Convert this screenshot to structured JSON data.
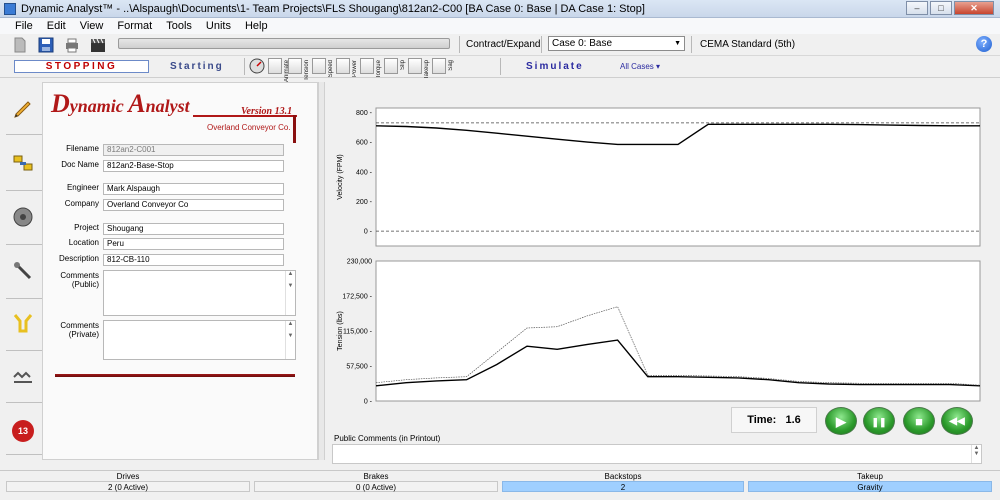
{
  "window": {
    "title": "Dynamic Analyst™ - ..\\Alspaugh\\Documents\\1- Team Projects\\FLS Shougang\\812an2-C00 [BA Case 0: Base | DA Case 1: Stop]",
    "minimize": "–",
    "maximize": "□",
    "close": "✕"
  },
  "menu": [
    "File",
    "Edit",
    "View",
    "Format",
    "Tools",
    "Units",
    "Help"
  ],
  "toolbar": {
    "contract_expand": "Contract/Expand",
    "case_select": "Case 0: Base",
    "standard": "CEMA Standard (5th)",
    "help": "?"
  },
  "modes": {
    "stopping": "STOPPING",
    "starting": "Starting",
    "simulate": "Simulate",
    "all_cases": "All Cases ▾",
    "tools": [
      "Animate",
      "Tension",
      "Speed",
      "Power",
      "Torque",
      "Slip",
      "Takeup",
      "Sag"
    ]
  },
  "sidebar": {
    "icons": [
      "pencil-icon",
      "drive-icon",
      "pulley-icon",
      "probe-icon",
      "takeup-icon",
      "belt-icon",
      "case-badge-icon"
    ],
    "badge": "13"
  },
  "logo": {
    "title_cap1": "D",
    "title_rest1": "ynamic ",
    "title_cap2": "A",
    "title_rest2": "nalyst",
    "version": "Version 13.1",
    "company": "Overland Conveyor Co."
  },
  "form": {
    "filename_label": "Filename",
    "filename": "812an2-C001",
    "docname_label": "Doc Name",
    "docname": "812an2-Base-Stop",
    "engineer_label": "Engineer",
    "engineer": "Mark Alspaugh",
    "company_label": "Company",
    "company": "Overland Conveyor Co",
    "project_label": "Project",
    "project": "Shougang",
    "location_label": "Location",
    "location": "Peru",
    "description_label": "Description",
    "description": "812-CB-110",
    "comments_public_label": "Comments (Public)",
    "comments_private_label": "Comments (Private)"
  },
  "chart_data": [
    {
      "type": "line",
      "ylabel": "Velocity (FPM)",
      "ylim": [
        -100,
        830
      ],
      "yticks": [
        "800 -",
        "600 -",
        "400 -",
        "200 -",
        "0 -"
      ],
      "x": [
        0,
        1,
        2,
        3,
        4,
        5,
        6,
        7,
        8,
        9,
        10,
        11,
        12,
        13,
        14,
        15,
        16,
        17,
        18,
        19,
        20
      ],
      "series": [
        {
          "values": [
            710,
            705,
            695,
            680,
            660,
            640,
            620,
            600,
            585,
            585,
            585,
            720,
            720,
            720,
            720,
            720,
            718,
            715,
            712,
            710,
            710
          ]
        }
      ],
      "reference_lines": [
        730,
        0
      ]
    },
    {
      "type": "line",
      "ylabel": "Tension (lbs)",
      "ylim": [
        0,
        230000
      ],
      "yticks": [
        "230,000",
        "172,500 -",
        "115,000 -",
        "57,500 -",
        "0 -"
      ],
      "x": [
        0,
        1,
        2,
        3,
        4,
        5,
        6,
        7,
        8,
        9,
        10,
        11,
        12,
        13,
        14,
        15,
        16,
        17,
        18,
        19,
        20
      ],
      "series": [
        {
          "values": [
            25000,
            30000,
            33000,
            35000,
            60000,
            90000,
            85000,
            93000,
            100000,
            40000,
            40000,
            39000,
            38000,
            35000,
            30000,
            28000,
            27000,
            27000,
            27000,
            27000,
            25000
          ]
        },
        {
          "values": [
            30000,
            35000,
            38000,
            40000,
            80000,
            120000,
            122000,
            140000,
            155000,
            42000,
            42000,
            41000,
            40000,
            37000,
            32000,
            30000,
            29000,
            29000,
            29000,
            29000,
            26000
          ]
        }
      ]
    }
  ],
  "playback": {
    "time_label": "Time:",
    "time_value": "1.6",
    "play": "▶",
    "pause": "❚❚",
    "stop": "■",
    "rewind": "◀◀"
  },
  "public_comments_label": "Public Comments (in Printout)",
  "status": {
    "drives_label": "Drives",
    "drives_value": "2 (0 Active)",
    "brakes_label": "Brakes",
    "brakes_value": "0 (0 Active)",
    "backstops_label": "Backstops",
    "backstops_value": "2",
    "takeup_label": "Takeup",
    "takeup_value": "Gravity"
  },
  "colors": {
    "accent_red": "#b01818",
    "highlight_blue": "#9fcfff",
    "play_green": "#2b9a2b"
  }
}
